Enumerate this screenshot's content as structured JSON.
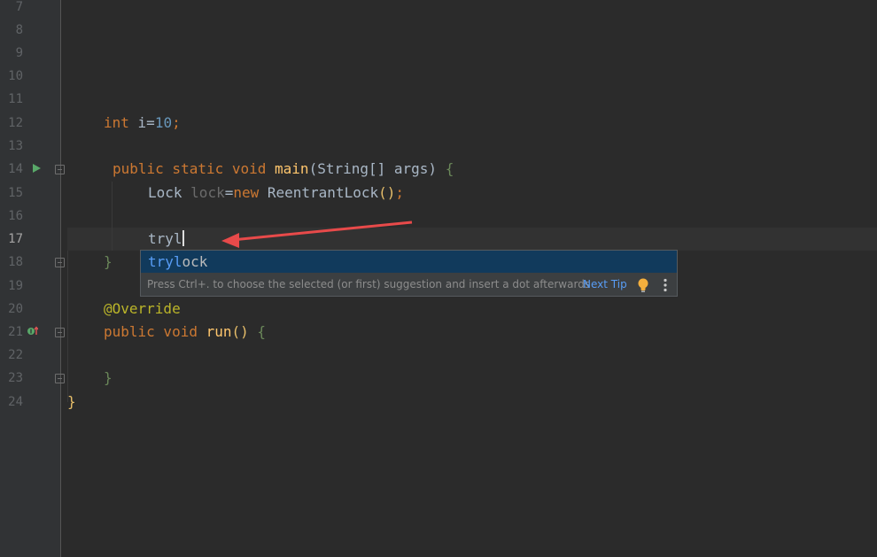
{
  "gutter": {
    "line_numbers": [
      "7",
      "8",
      "9",
      "10",
      "11",
      "12",
      "13",
      "14",
      "15",
      "16",
      "17",
      "18",
      "19",
      "20",
      "21",
      "22",
      "23",
      "24"
    ],
    "current_line": "17"
  },
  "code": {
    "line12": {
      "kw": "int",
      "var": " i",
      "eq": "=",
      "num": "10",
      "semi": ";"
    },
    "line14": {
      "kw": "public static void ",
      "fn": "main",
      "p1": "(String[] args) ",
      "brace": "{"
    },
    "line15": {
      "t1": "Lock ",
      "var": "lock",
      "eq": "=",
      "kw": "new ",
      "t2": "ReentrantLock",
      "paren": "()",
      "semi": ";"
    },
    "line17": {
      "typed": "tryl"
    },
    "line18": {
      "brace": "}"
    },
    "line20": {
      "ann": "@Override"
    },
    "line21": {
      "kw": "public void ",
      "fn": "run",
      "paren": "() ",
      "brace": "{"
    },
    "line23": {
      "brace": "}"
    },
    "line24": {
      "brace": "}"
    }
  },
  "completion": {
    "item_match": "tryl",
    "item_rest": "ock",
    "hint": "Press Ctrl+. to choose the selected (or first) suggestion and insert a dot afterwards",
    "next_tip": "Next Tip"
  },
  "icons": {
    "run": "run-gutter-icon",
    "implements": "implements-method-icon",
    "bulb": "lightbulb-icon",
    "more": "more-vertical-icon"
  },
  "colors": {
    "background": "#2b2b2b",
    "keyword": "#cc7832",
    "function": "#ffc66d",
    "number": "#6897bb",
    "annotation": "#bbb529",
    "selection": "#113a5c",
    "arrow": "#e84a4a"
  }
}
